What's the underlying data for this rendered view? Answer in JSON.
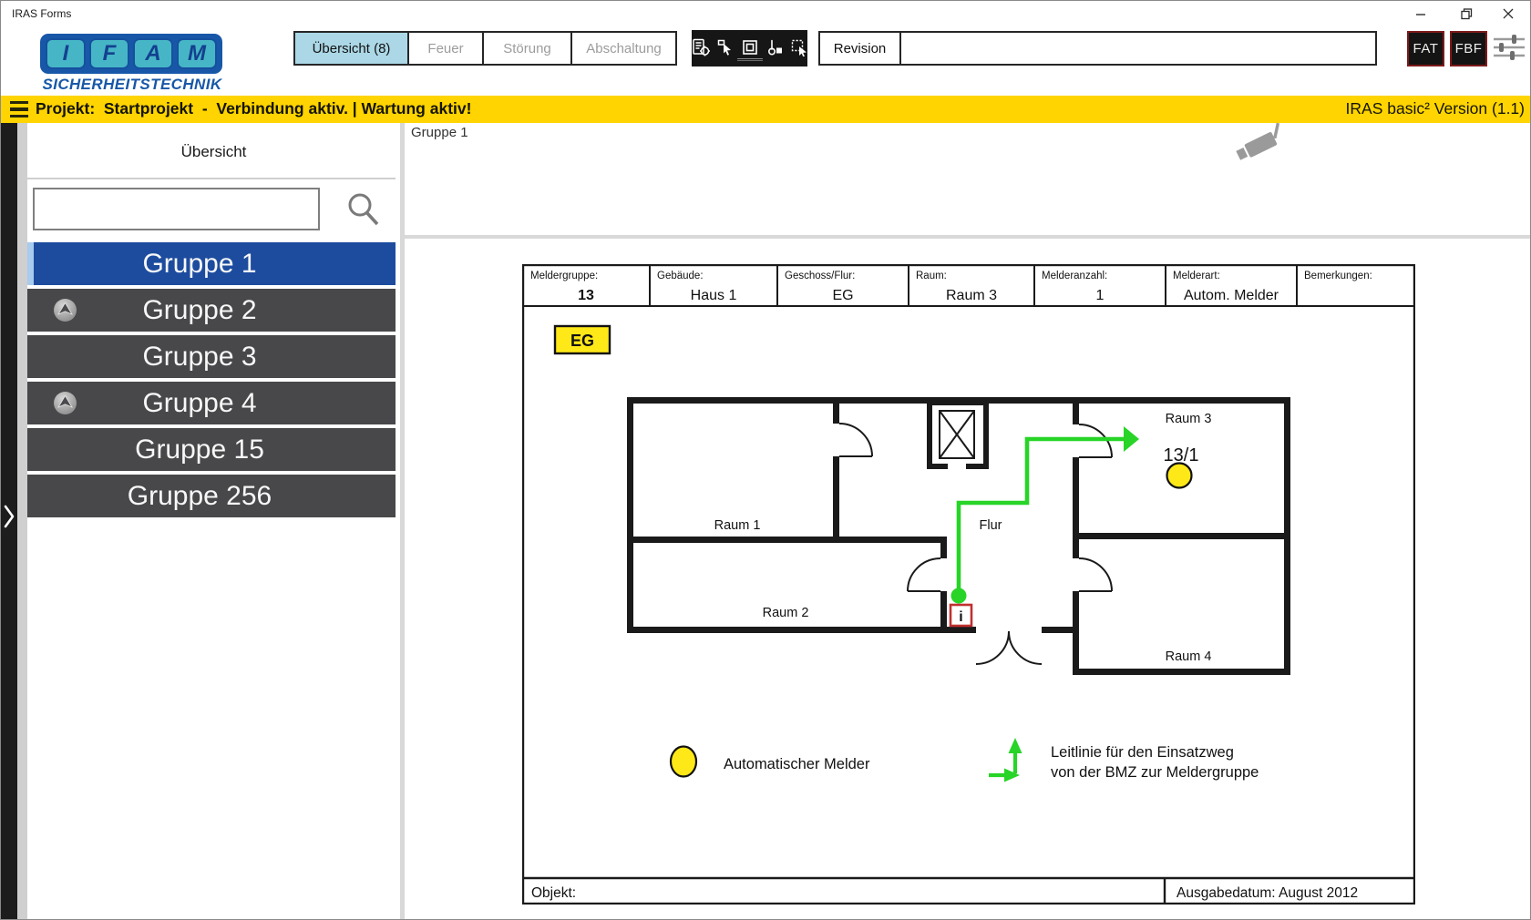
{
  "window": {
    "title": "IRAS Forms",
    "controls": {
      "minimize": "minimize",
      "maximize": "maximize",
      "close": "close"
    }
  },
  "colors": {
    "status_yellow": "#FFD400",
    "tab_active_blue": "#ABD7E6",
    "group_row_grey": "#48484B",
    "group_selected_blue": "#1D4C9F",
    "selected_accent": "#A8CBEE",
    "detector_yellow": "#FFE818",
    "route_green": "#27D427",
    "info_box_red": "#C03030",
    "logo_blue": "#1857A8",
    "logo_teal": "#46B6C6",
    "fat_border_red": "#7d1a1a"
  },
  "topbar": {
    "logo": {
      "letters": [
        "I",
        "F",
        "A",
        "M"
      ],
      "subtitle": "SICHERHEITSTECHNIK"
    },
    "tabs": [
      {
        "label": "Übersicht (8)"
      },
      {
        "label": "Feuer"
      },
      {
        "label": "Störung"
      },
      {
        "label": "Abschaltung"
      }
    ],
    "toolbar_icons": [
      "report-target-icon",
      "pointer-frame-icon",
      "frame-icon",
      "thermometer-icon",
      "pointer-select-icon"
    ],
    "revision_label": "Revision",
    "fat_label": "FAT",
    "fbf_label": "FBF"
  },
  "statusbar": {
    "left": "Projekt:  Startprojekt  -  Verbindung aktiv. | Wartung aktiv!",
    "right": "IRAS basic² Version (1.1)"
  },
  "sidebar": {
    "heading": "Übersicht",
    "search_value": "",
    "groups": [
      {
        "label": "Gruppe 1",
        "selected": true,
        "badge": false
      },
      {
        "label": "Gruppe 2",
        "selected": false,
        "badge": true
      },
      {
        "label": "Gruppe 3",
        "selected": false,
        "badge": false
      },
      {
        "label": "Gruppe 4",
        "selected": false,
        "badge": true
      },
      {
        "label": "Gruppe 15",
        "selected": false,
        "badge": false
      },
      {
        "label": "Gruppe 256",
        "selected": false,
        "badge": false
      }
    ]
  },
  "main": {
    "header": "Gruppe 1",
    "plan": {
      "table": [
        {
          "label": "Meldergruppe:",
          "value": "13"
        },
        {
          "label": "Gebäude:",
          "value": "Haus 1"
        },
        {
          "label": "Geschoss/Flur:",
          "value": "EG"
        },
        {
          "label": "Raum:",
          "value": "Raum 3"
        },
        {
          "label": "Melderanzahl:",
          "value": "1"
        },
        {
          "label": "Melderart:",
          "value": "Autom. Melder"
        },
        {
          "label": "Bemerkungen:",
          "value": ""
        }
      ],
      "floor_label": "EG",
      "rooms": {
        "room1": "Raum 1",
        "room2": "Raum 2",
        "room3": "Raum 3",
        "room4": "Raum 4",
        "corridor": "Flur"
      },
      "detector_id": "13/1",
      "info_marker": "i",
      "legend": {
        "detector_label": "Automatischer Melder",
        "route_line1": "Leitlinie für den Einsatzweg",
        "route_line2": "von der BMZ zur Meldergruppe"
      },
      "footer": {
        "left": "Objekt:",
        "right": "Ausgabedatum: August 2012"
      }
    }
  }
}
